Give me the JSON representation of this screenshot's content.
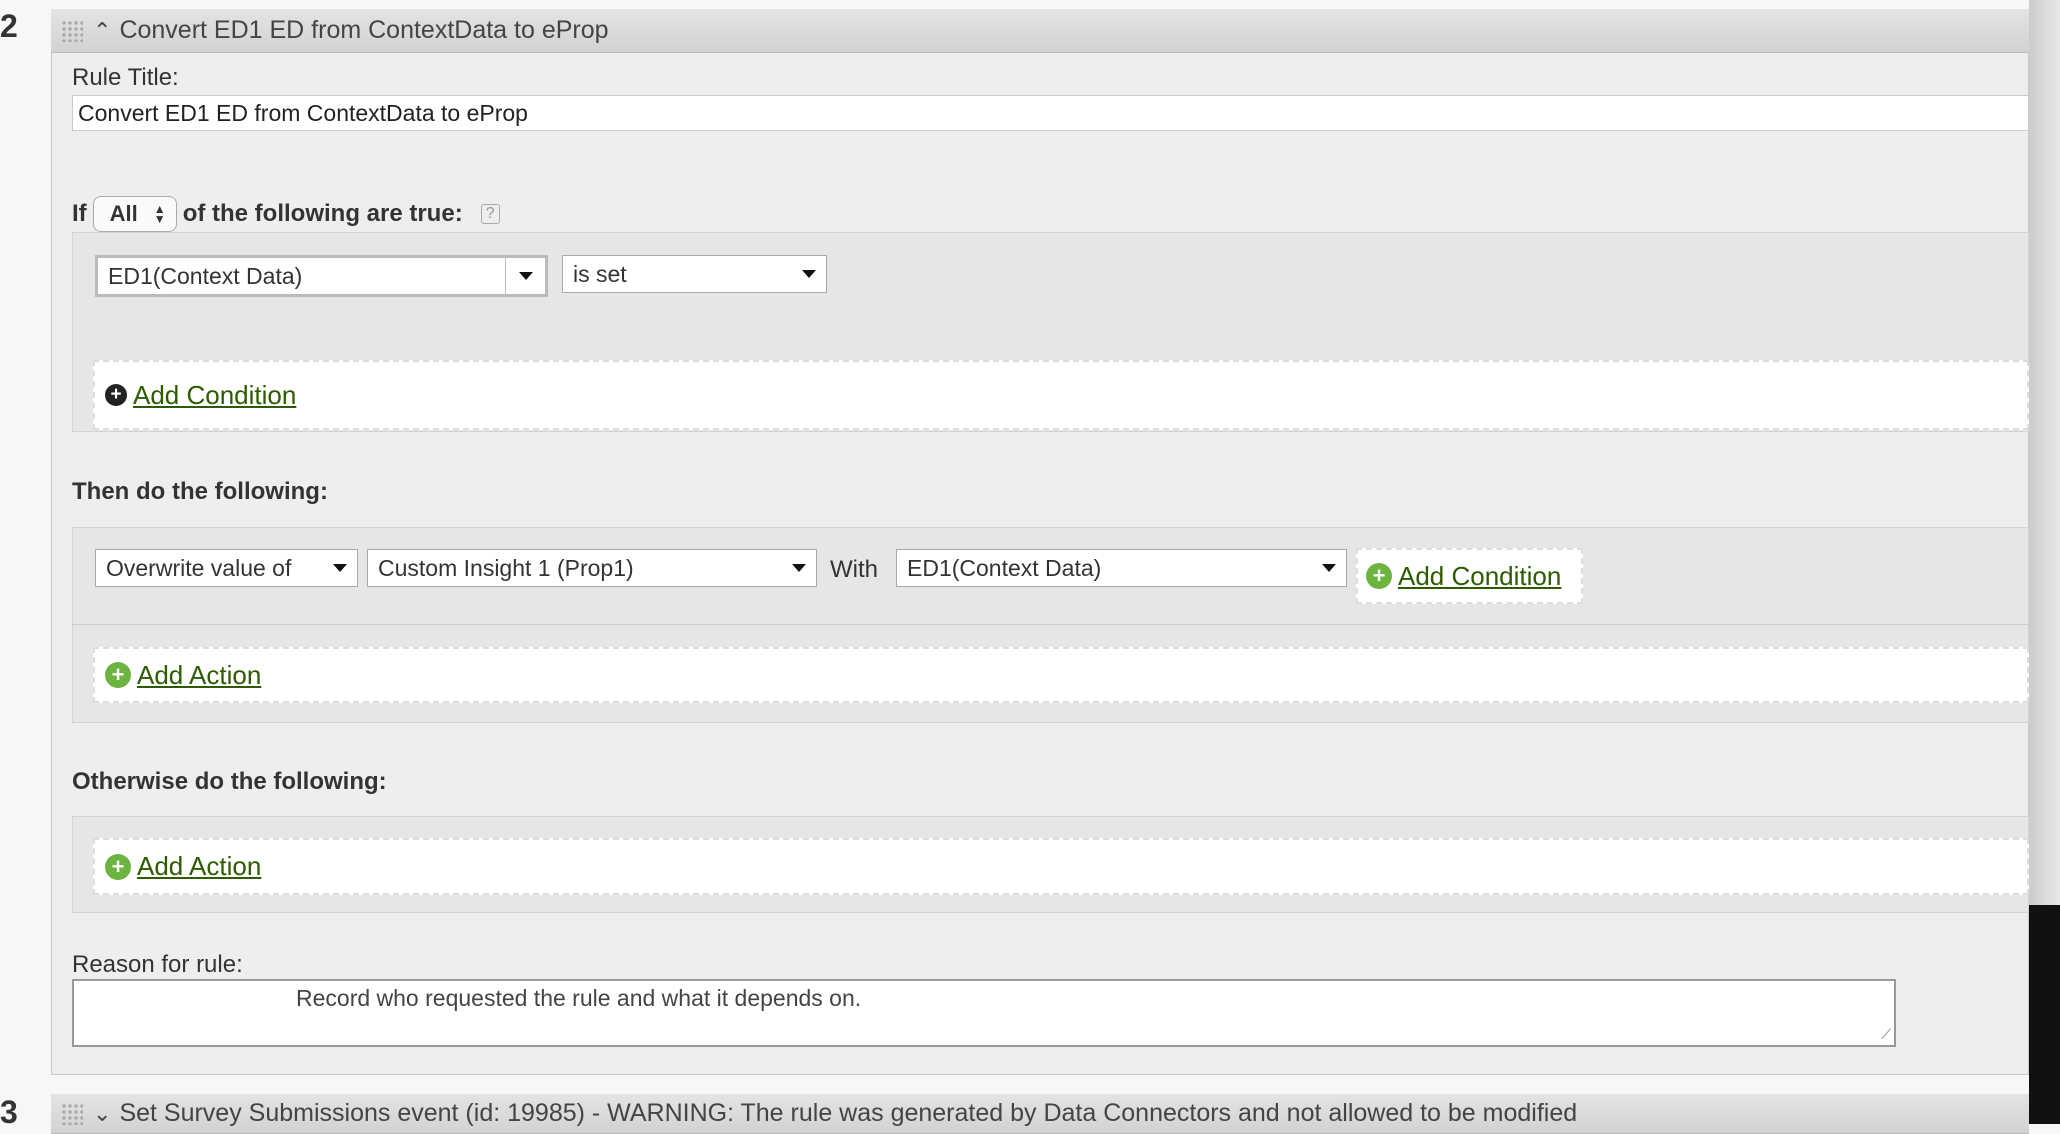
{
  "rule2": {
    "number": "2",
    "header_title": "Convert ED1 ED from ContextData to eProp",
    "rule_title_label": "Rule Title:",
    "rule_title_value": "Convert ED1 ED from ContextData to eProp",
    "if_label": "If",
    "match_select": "All",
    "if_suffix": "of the following are true:",
    "condition": {
      "field": "ED1(Context Data)",
      "operator": "is set"
    },
    "add_condition": "Add Condition",
    "then_label": "Then do the following:",
    "action": {
      "type": "Overwrite value of",
      "target": "Custom Insight 1 (Prop1)",
      "with_label": "With",
      "source": "ED1(Context Data)",
      "add_condition": "Add Condition"
    },
    "add_action": "Add Action",
    "otherwise_label": "Otherwise do the following:",
    "otherwise_add_action": "Add Action",
    "reason_label": "Reason for rule:",
    "reason_placeholder": "Record who requested the rule and what it depends on."
  },
  "rule3": {
    "number": "3",
    "header_title": "Set Survey Submissions event (id: 19985) - WARNING: The rule was generated by Data Connectors and not allowed to be modified"
  }
}
